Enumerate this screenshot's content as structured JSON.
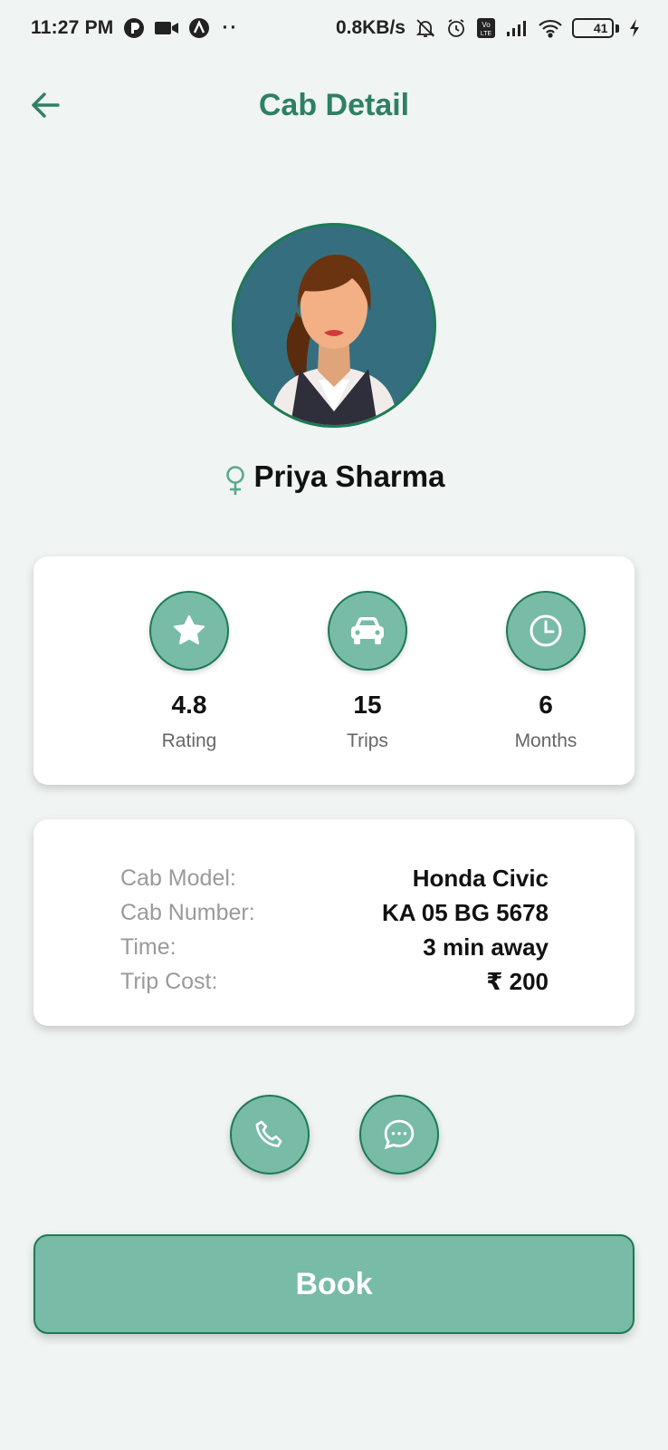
{
  "status_bar": {
    "time": "11:27 PM",
    "network_speed": "0.8KB/s",
    "battery_level": "41",
    "battery_fraction": 0.41,
    "icons": [
      "p-app-icon",
      "video-icon",
      "a-app-icon",
      "more-dots-icon",
      "mute-bell-icon",
      "alarm-icon",
      "volte-icon",
      "signal-icon",
      "wifi-icon",
      "battery-icon",
      "charging-icon"
    ]
  },
  "header": {
    "title": "Cab Detail",
    "back_icon": "arrow-left-icon"
  },
  "driver": {
    "name": "Priya Sharma",
    "gender_icon": "female-symbol-icon",
    "avatar": "female-driver-avatar"
  },
  "stats": [
    {
      "icon": "star-icon",
      "value": "4.8",
      "label": "Rating"
    },
    {
      "icon": "car-icon",
      "value": "15",
      "label": "Trips"
    },
    {
      "icon": "clock-icon",
      "value": "6",
      "label": "Months"
    }
  ],
  "cab_info": [
    {
      "label": "Cab Model:",
      "value": "Honda Civic"
    },
    {
      "label": "Cab Number:",
      "value": "KA 05 BG 5678"
    },
    {
      "label": "Time:",
      "value": "3 min away"
    },
    {
      "label": "Trip Cost:",
      "value": "₹ 200"
    }
  ],
  "actions": {
    "call_icon": "phone-icon",
    "chat_icon": "chat-bubble-icon",
    "book_label": "Book"
  },
  "colors": {
    "accent": "#2e8064",
    "button_fill": "#78bba7",
    "button_border": "#1d7a55",
    "background": "#f0f4f3"
  }
}
